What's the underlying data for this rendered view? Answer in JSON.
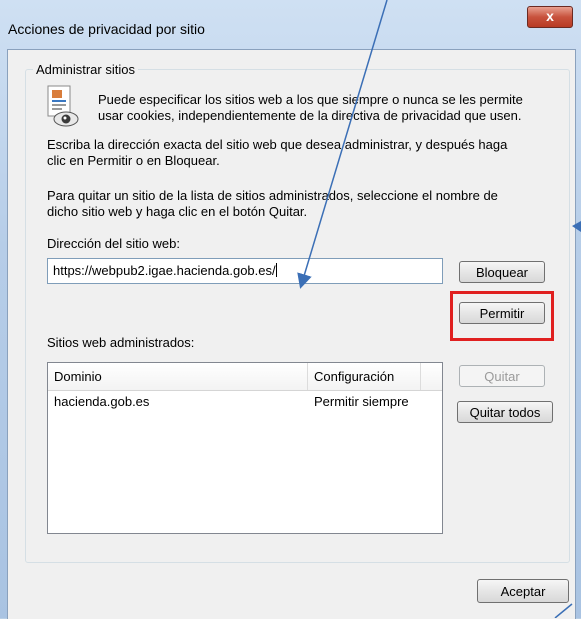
{
  "window": {
    "title": "Acciones de privacidad por sitio",
    "close_label": "x"
  },
  "group": {
    "legend": "Administrar sitios",
    "intro_line1": "Puede especificar los sitios web a los que siempre o nunca se les permite",
    "intro_line2": "usar cookies, independientemente de la directiva de privacidad que usen.",
    "instr1_line1": "Escriba la dirección exacta del sitio web que desea administrar, y después haga",
    "instr1_line2": "clic en Permitir o en Bloquear.",
    "instr2_line1": "Para quitar un sitio de la lista de sitios administrados, seleccione el nombre de",
    "instr2_line2": "dicho sitio web y haga clic en el botón Quitar.",
    "address_label": "Dirección del sitio web:",
    "address_value": "https://webpub2.igae.hacienda.gob.es/",
    "managed_label": "Sitios web administrados:"
  },
  "buttons": {
    "block": "Bloquear",
    "allow": "Permitir",
    "remove": "Quitar",
    "remove_all": "Quitar todos",
    "ok": "Aceptar"
  },
  "table": {
    "headers": {
      "domain": "Dominio",
      "setting": "Configuración"
    },
    "rows": [
      {
        "domain": "hacienda.gob.es",
        "setting": "Permitir siempre"
      }
    ]
  },
  "colors": {
    "highlight": "#e02020",
    "annotation_arrow": "#3b6fb6"
  }
}
